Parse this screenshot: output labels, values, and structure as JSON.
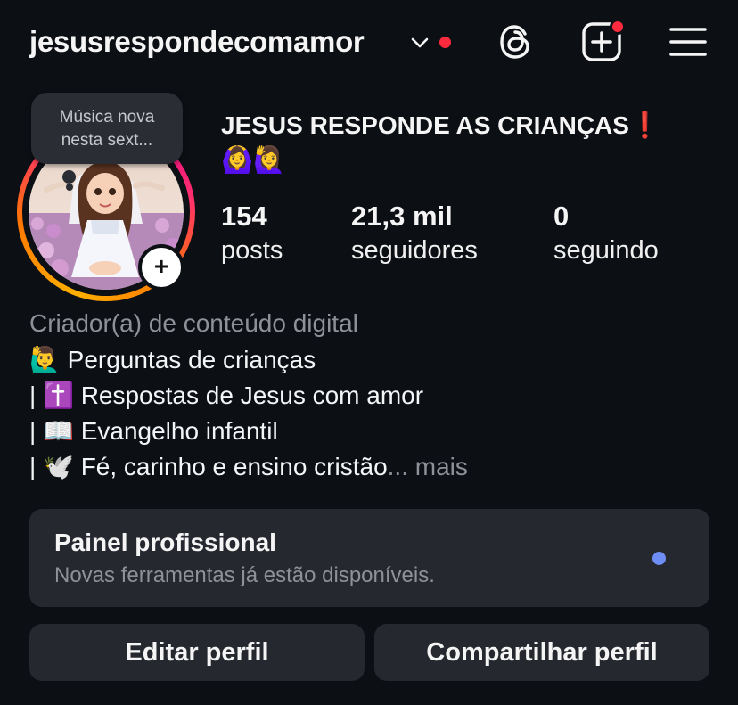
{
  "header": {
    "username": "jesusrespondecomamor",
    "icons": [
      "chevron-down-icon",
      "threads-icon",
      "new-post-icon",
      "menu-icon"
    ],
    "notification_color": "#ff2a3d"
  },
  "note": {
    "text_line1": "Música nova",
    "text_line2": "nesta sext..."
  },
  "profile": {
    "full_name": "JESUS RESPONDE AS CRIANÇAS",
    "exclamation": "❗",
    "name_emojis": "🙆‍♀️🙋‍♀️",
    "stats": {
      "posts_count": "154",
      "posts_label": "posts",
      "followers_count": "21,3 mil",
      "followers_label": "seguidores",
      "following_count": "0",
      "following_label": "seguindo"
    }
  },
  "bio": {
    "category": "Criador(a) de conteúdo digital",
    "line1": "🙋‍♂️ Perguntas de crianças",
    "line2": "| ✝️ Respostas de Jesus com amor",
    "line3": "| 📖 Evangelho infantil",
    "line4": "| 🕊️ Fé, carinho e ensino cristão",
    "ellipsis": "...",
    "more": "mais"
  },
  "dashboard": {
    "title": "Painel profissional",
    "subtitle": "Novas ferramentas já estão disponíveis.",
    "dot_color": "#6f8ef5"
  },
  "actions": {
    "edit_profile": "Editar perfil",
    "share_profile": "Compartilhar perfil"
  }
}
